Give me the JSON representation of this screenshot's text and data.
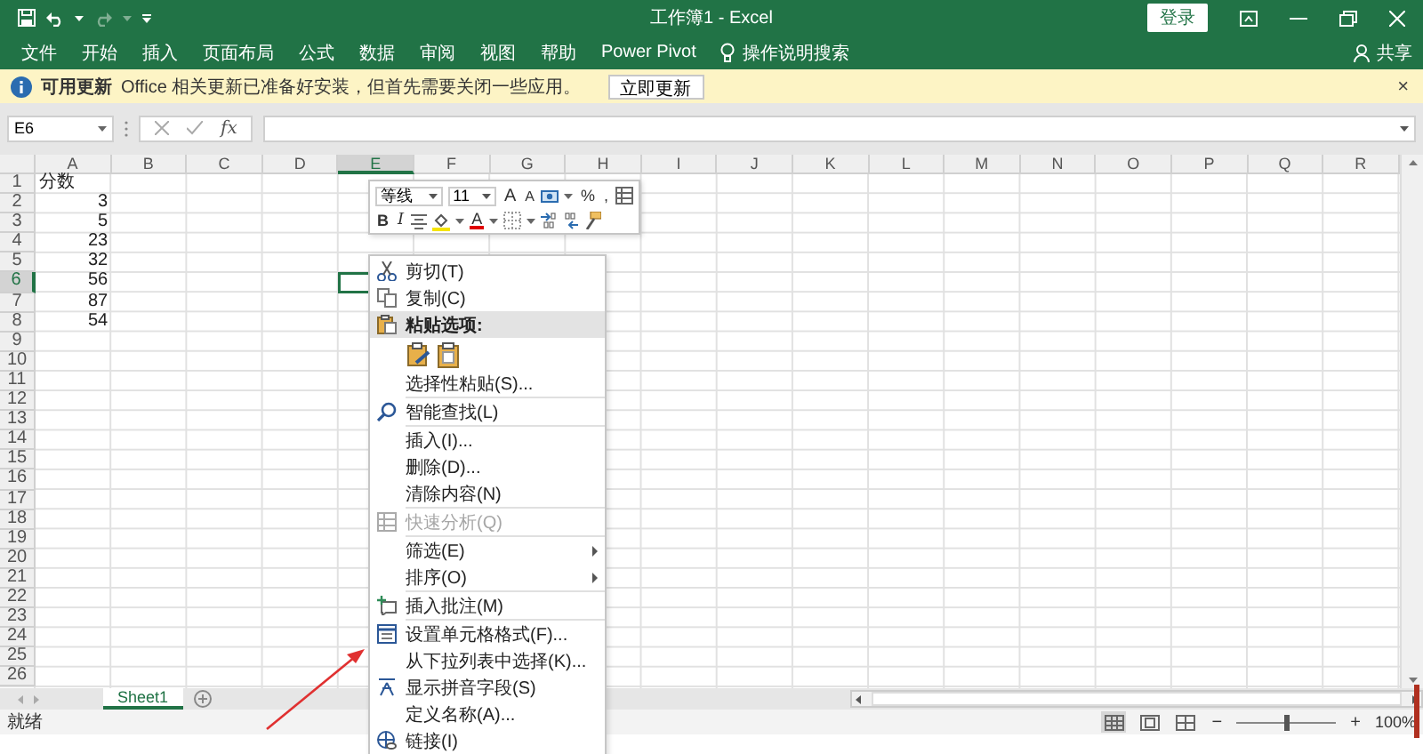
{
  "window": {
    "title": "工作簿1 - Excel",
    "sign_in": "登录"
  },
  "ribbon_tabs": [
    {
      "label": "文件"
    },
    {
      "label": "开始"
    },
    {
      "label": "插入"
    },
    {
      "label": "页面布局"
    },
    {
      "label": "公式"
    },
    {
      "label": "数据"
    },
    {
      "label": "审阅"
    },
    {
      "label": "视图"
    },
    {
      "label": "帮助"
    },
    {
      "label": "Power Pivot"
    }
  ],
  "tell_me": "操作说明搜索",
  "share": "共享",
  "info_bar": {
    "title": "可用更新",
    "message": "Office 相关更新已准备好安装，但首先需要关闭一些应用。",
    "button": "立即更新",
    "close": "×"
  },
  "formula_bar": {
    "name_box": "E6",
    "function_label": "fx"
  },
  "columns": [
    {
      "label": "A",
      "selected": false
    },
    {
      "label": "B",
      "selected": false
    },
    {
      "label": "C",
      "selected": false
    },
    {
      "label": "D",
      "selected": false
    },
    {
      "label": "E",
      "selected": true
    },
    {
      "label": "F",
      "selected": false
    },
    {
      "label": "G",
      "selected": false
    },
    {
      "label": "H",
      "selected": false
    },
    {
      "label": "I",
      "selected": false
    },
    {
      "label": "J",
      "selected": false
    },
    {
      "label": "K",
      "selected": false
    },
    {
      "label": "L",
      "selected": false
    },
    {
      "label": "M",
      "selected": false
    },
    {
      "label": "N",
      "selected": false
    },
    {
      "label": "O",
      "selected": false
    },
    {
      "label": "P",
      "selected": false
    },
    {
      "label": "Q",
      "selected": false
    },
    {
      "label": "R",
      "selected": false
    }
  ],
  "rows": [
    {
      "header": "1",
      "selected": false,
      "cells": [
        {
          "value": "分数",
          "kind": "text"
        }
      ]
    },
    {
      "header": "2",
      "selected": false,
      "cells": [
        {
          "value": "3",
          "kind": "number"
        }
      ]
    },
    {
      "header": "3",
      "selected": false,
      "cells": [
        {
          "value": "5",
          "kind": "number"
        }
      ]
    },
    {
      "header": "4",
      "selected": false,
      "cells": [
        {
          "value": "23",
          "kind": "number"
        }
      ]
    },
    {
      "header": "5",
      "selected": false,
      "cells": [
        {
          "value": "32",
          "kind": "number"
        }
      ]
    },
    {
      "header": "6",
      "selected": true,
      "cells": [
        {
          "value": "56",
          "kind": "number"
        }
      ]
    },
    {
      "header": "7",
      "selected": false,
      "cells": [
        {
          "value": "87",
          "kind": "number"
        }
      ]
    },
    {
      "header": "8",
      "selected": false,
      "cells": [
        {
          "value": "54",
          "kind": "number"
        }
      ]
    },
    {
      "header": "9",
      "selected": false
    },
    {
      "header": "10",
      "selected": false
    },
    {
      "header": "11",
      "selected": false
    },
    {
      "header": "12",
      "selected": false
    },
    {
      "header": "13",
      "selected": false
    },
    {
      "header": "14",
      "selected": false
    },
    {
      "header": "15",
      "selected": false
    },
    {
      "header": "16",
      "selected": false
    },
    {
      "header": "17",
      "selected": false
    },
    {
      "header": "18",
      "selected": false
    },
    {
      "header": "19",
      "selected": false
    },
    {
      "header": "20",
      "selected": false
    },
    {
      "header": "21",
      "selected": false
    },
    {
      "header": "22",
      "selected": false
    },
    {
      "header": "23",
      "selected": false
    },
    {
      "header": "24",
      "selected": false
    },
    {
      "header": "25",
      "selected": false
    },
    {
      "header": "26",
      "selected": false
    }
  ],
  "mini_toolbar": {
    "font": "等线",
    "size": "11",
    "row_1": [
      {
        "kind": "grow",
        "glyph": "A"
      },
      {
        "kind": "shrink",
        "glyph": "A"
      },
      {
        "kind": "currency"
      },
      {
        "kind": "percent",
        "glyph": "%"
      },
      {
        "kind": "comma",
        "glyph": ","
      },
      {
        "kind": "format"
      }
    ],
    "row_2": [
      {
        "kind": "bold",
        "glyph": "B"
      },
      {
        "kind": "italic",
        "glyph": "I"
      },
      {
        "kind": "center"
      },
      {
        "kind": "fill"
      },
      {
        "kind": "fontcolor",
        "glyph": "A"
      },
      {
        "kind": "borders"
      },
      {
        "kind": "incdec"
      },
      {
        "kind": "decdec"
      },
      {
        "kind": "painter"
      }
    ]
  },
  "context_menu": [
    {
      "kind": "cut",
      "label": "剪切(T)",
      "disabled": false
    },
    {
      "kind": "copy",
      "label": "复制(C)",
      "disabled": false
    },
    {
      "kind": "paste",
      "label": "粘贴选项:",
      "disabled": false
    },
    {
      "kind": "pastebuttons",
      "disabled": false
    },
    {
      "kind": "plain",
      "label": "选择性粘贴(S)...",
      "disabled": false
    },
    {
      "kind": "separator"
    },
    {
      "kind": "search",
      "label": "智能查找(L)",
      "disabled": false
    },
    {
      "kind": "separator"
    },
    {
      "kind": "plain",
      "label": "插入(I)...",
      "disabled": false
    },
    {
      "kind": "plain",
      "label": "删除(D)...",
      "disabled": false
    },
    {
      "kind": "plain",
      "label": "清除内容(N)",
      "disabled": false
    },
    {
      "kind": "separator"
    },
    {
      "kind": "analysis",
      "label": "快速分析(Q)",
      "disabled": true
    },
    {
      "kind": "separator"
    },
    {
      "kind": "submenu",
      "label": "筛选(E)",
      "disabled": false
    },
    {
      "kind": "submenu",
      "label": "排序(O)",
      "disabled": false
    },
    {
      "kind": "separator"
    },
    {
      "kind": "comment",
      "label": "插入批注(M)",
      "disabled": false
    },
    {
      "kind": "separator"
    },
    {
      "kind": "format",
      "label": "设置单元格格式(F)...",
      "disabled": false
    },
    {
      "kind": "plain",
      "label": "从下拉列表中选择(K)...",
      "disabled": false
    },
    {
      "kind": "pinyin",
      "label": "显示拼音字段(S)",
      "disabled": false
    },
    {
      "kind": "plain",
      "label": "定义名称(A)...",
      "disabled": false
    },
    {
      "kind": "link",
      "label": "链接(I)",
      "disabled": false
    }
  ],
  "sheet_tabs": [
    {
      "label": "Sheet1",
      "selected": true
    }
  ],
  "status_bar": {
    "status": "就绪",
    "views": [
      {
        "kind": "normal",
        "selected": true
      },
      {
        "kind": "layout",
        "selected": false
      },
      {
        "kind": "pagebreak",
        "selected": false
      }
    ],
    "zoom_out": "−",
    "zoom_in": "+",
    "zoom": {
      "level": 0.5,
      "reading": "100%"
    }
  }
}
